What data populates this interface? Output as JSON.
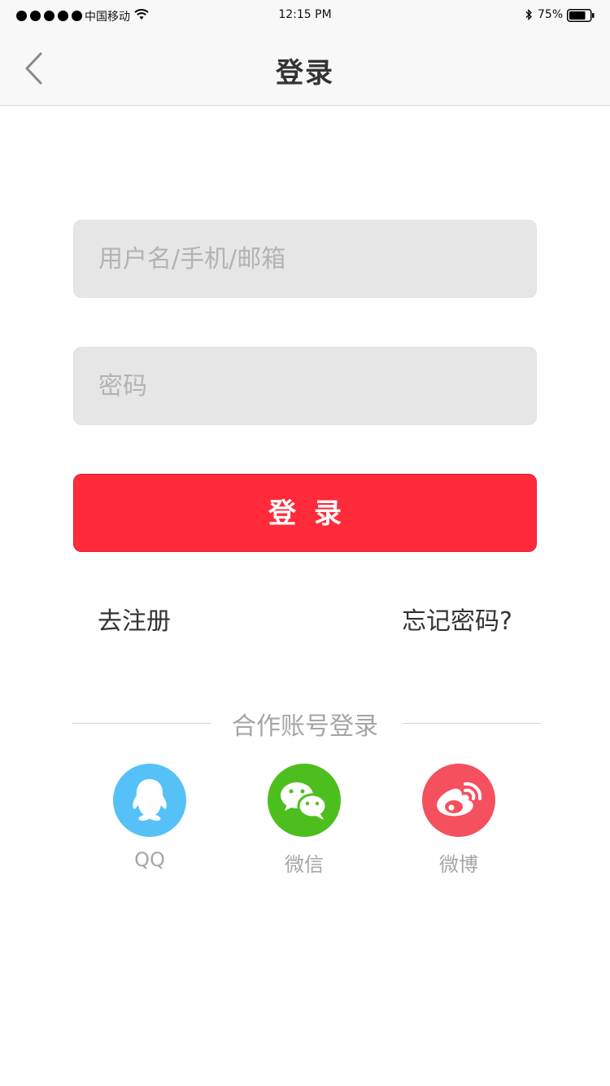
{
  "status_bar": {
    "carrier": "中国移动",
    "time": "12:15 PM",
    "battery": "75%"
  },
  "nav": {
    "title": "登录",
    "back_icon": "chevron-left-icon"
  },
  "form": {
    "username_placeholder": "用户名/手机/邮箱",
    "username_value": "",
    "password_placeholder": "密码",
    "password_value": "",
    "login_label": "登录"
  },
  "links": {
    "register": "去注册",
    "forgot": "忘记密码?"
  },
  "social": {
    "heading": "合作账号登录",
    "items": [
      {
        "label": "QQ",
        "icon": "qq-icon",
        "color": "#56c1f7"
      },
      {
        "label": "微信",
        "icon": "wechat-icon",
        "color": "#4cbf1e"
      },
      {
        "label": "微博",
        "icon": "weibo-icon",
        "color": "#f4505e"
      }
    ]
  },
  "colors": {
    "accent": "#ff2a3a",
    "input_bg": "#e6e6e6"
  }
}
